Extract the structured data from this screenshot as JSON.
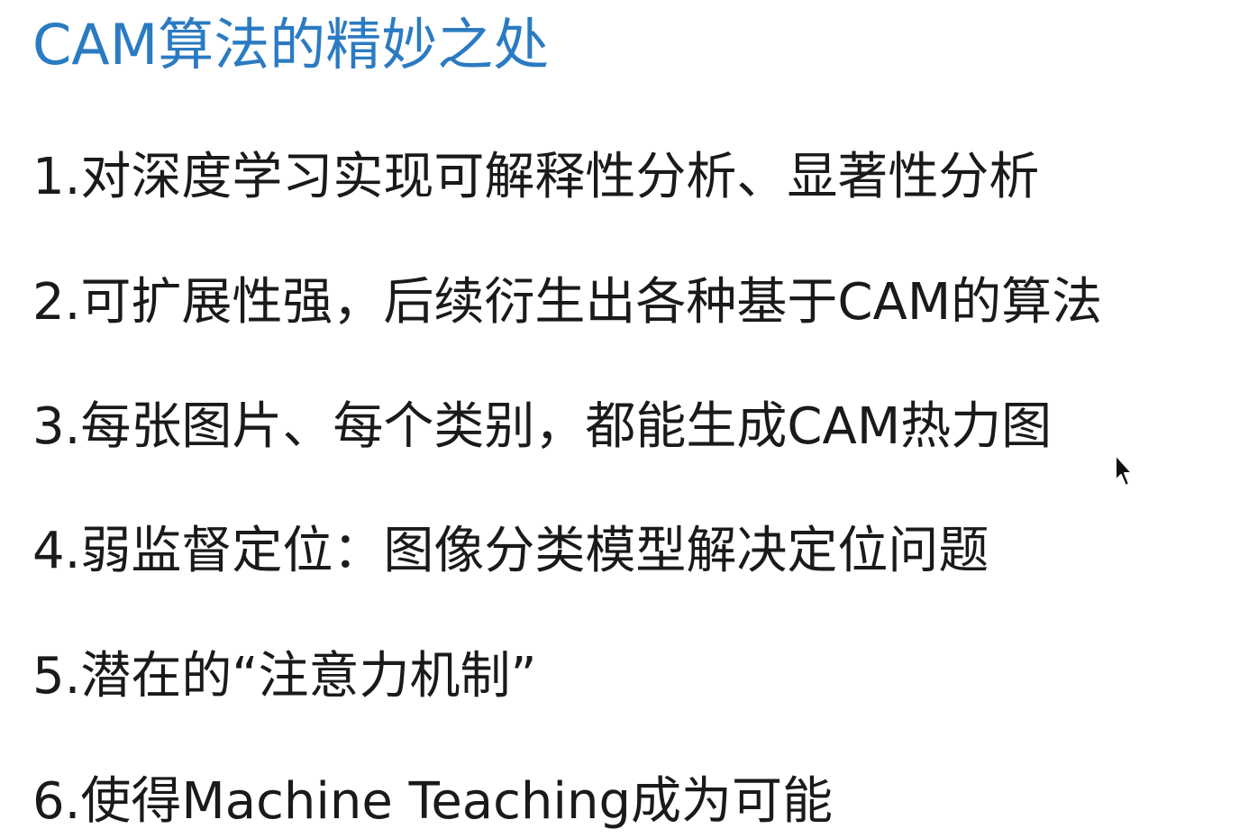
{
  "slide": {
    "title": "CAM算法的精妙之处",
    "items": [
      "1.对深度学习实现可解释性分析、显著性分析",
      "2.可扩展性强，后续衍生出各种基于CAM的算法",
      "3.每张图片、每个类别，都能生成CAM热力图",
      "4.弱监督定位：图像分类模型解决定位问题",
      "5.潜在的“注意力机制”",
      "6.使得Machine Teaching成为可能"
    ]
  },
  "colors": {
    "title": "#2b7bc2",
    "text": "#1a1a1a",
    "background": "#ffffff"
  },
  "icons": {
    "cursor": "mouse-pointer-icon"
  }
}
